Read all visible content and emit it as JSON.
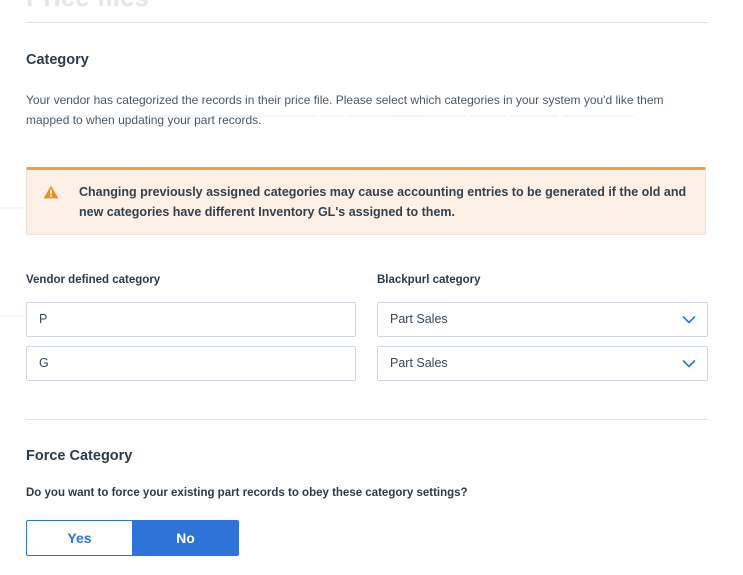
{
  "header": {
    "title": "Price files"
  },
  "category_section": {
    "title": "Category",
    "description": "Your vendor has categorized the records in their price file. Please select which categories in your system you'd like them mapped to when updating your part records.",
    "warning": "Changing previously assigned categories may cause accounting entries to be generated if the old and new categories have different Inventory GL's assigned to them.",
    "vendor_column_label": "Vendor defined category",
    "blackpurl_column_label": "Blackpurl category",
    "mappings": [
      {
        "vendor": "P",
        "blackpurl": "Part Sales"
      },
      {
        "vendor": "G",
        "blackpurl": "Part Sales"
      }
    ]
  },
  "force_category": {
    "title": "Force Category",
    "question": "Do you want to force your existing part records to obey these category settings?",
    "yes_label": "Yes",
    "no_label": "No",
    "selected": "No"
  },
  "colors": {
    "accent": "#2d73d8",
    "warning_border": "#f5a03a",
    "warning_bg": "#fdf0e6",
    "warning_icon": "#e8901f"
  },
  "icons": {
    "warning": "warning-triangle-icon",
    "dropdown": "chevron-down-icon"
  }
}
